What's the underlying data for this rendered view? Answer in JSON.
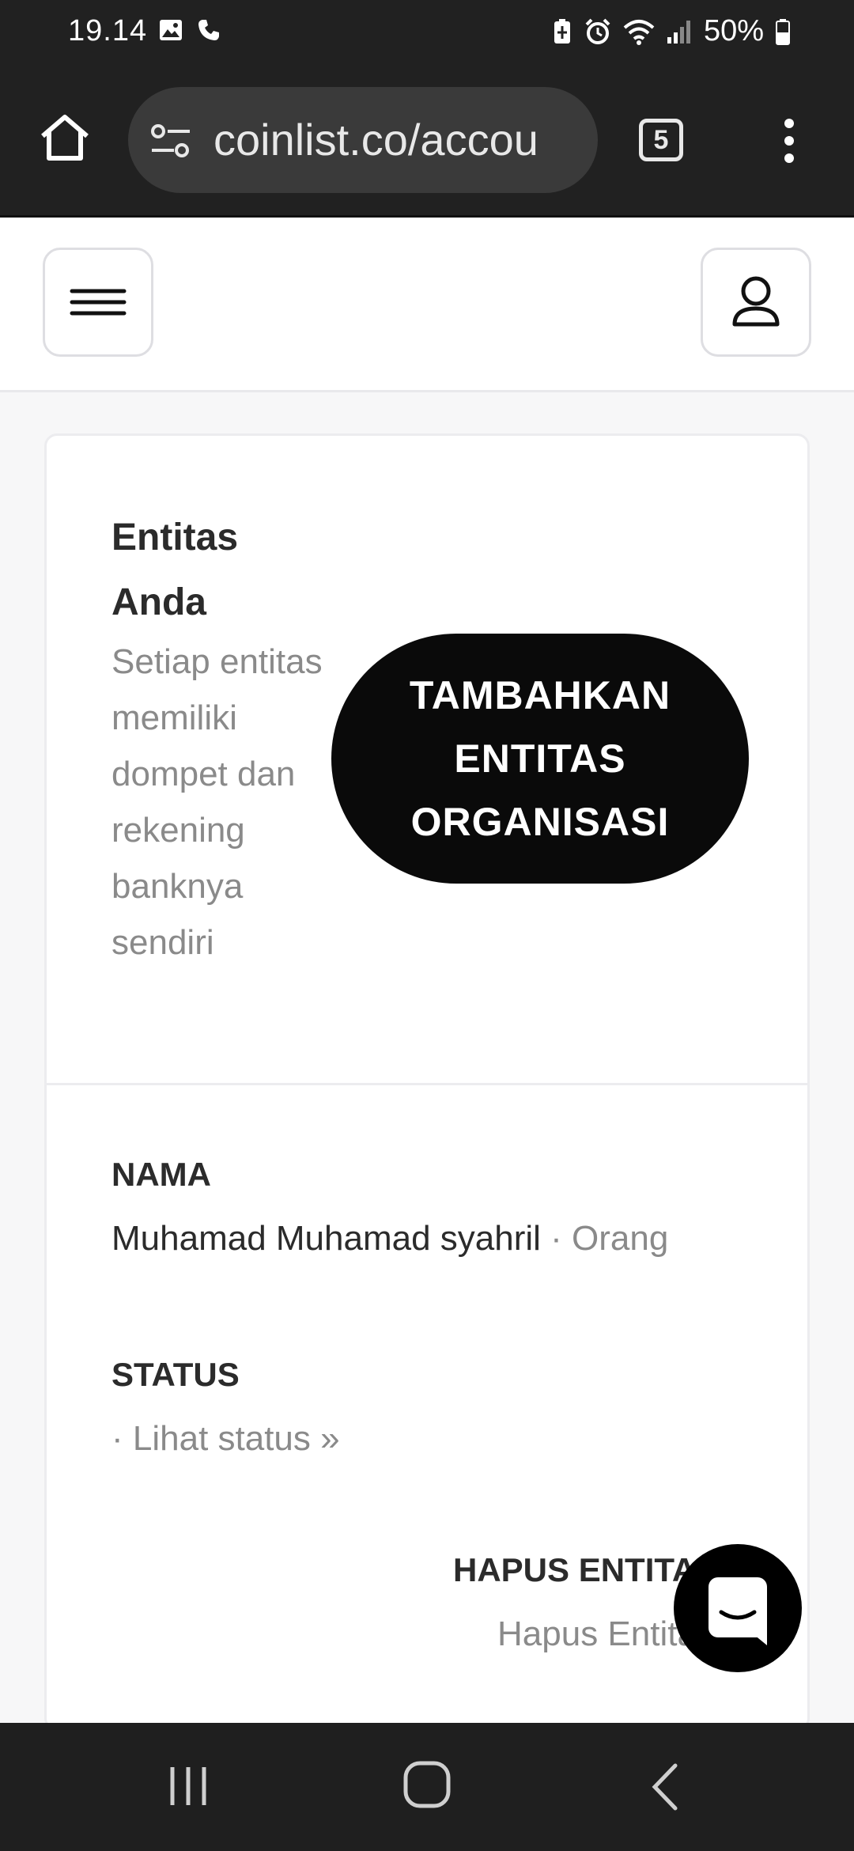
{
  "status_bar": {
    "time": "19.14",
    "battery": "50%"
  },
  "browser": {
    "url": "coinlist.co/accou",
    "tab_count": "5"
  },
  "entities": {
    "title": "Entitas Anda",
    "description": "Setiap entitas memiliki dompet dan rekening banknya sendiri",
    "add_button_label": "TAMBAHKAN ENTITAS ORGANISASI"
  },
  "entity": {
    "name_label": "NAMA",
    "name_value": "Muhamad Muhamad syahril",
    "name_type": "· Orang",
    "status_label": "STATUS",
    "status_link": "· Lihat status »",
    "delete_label": "HAPUS ENTITAS",
    "delete_link": "Hapus Entitas"
  },
  "icons": {
    "home": "home-icon",
    "site_settings": "tune-icon",
    "tabs": "tab-switcher-icon",
    "menu": "more-vert-icon",
    "hamburger": "hamburger-menu-icon",
    "profile": "user-icon",
    "chat": "chat-icon"
  }
}
